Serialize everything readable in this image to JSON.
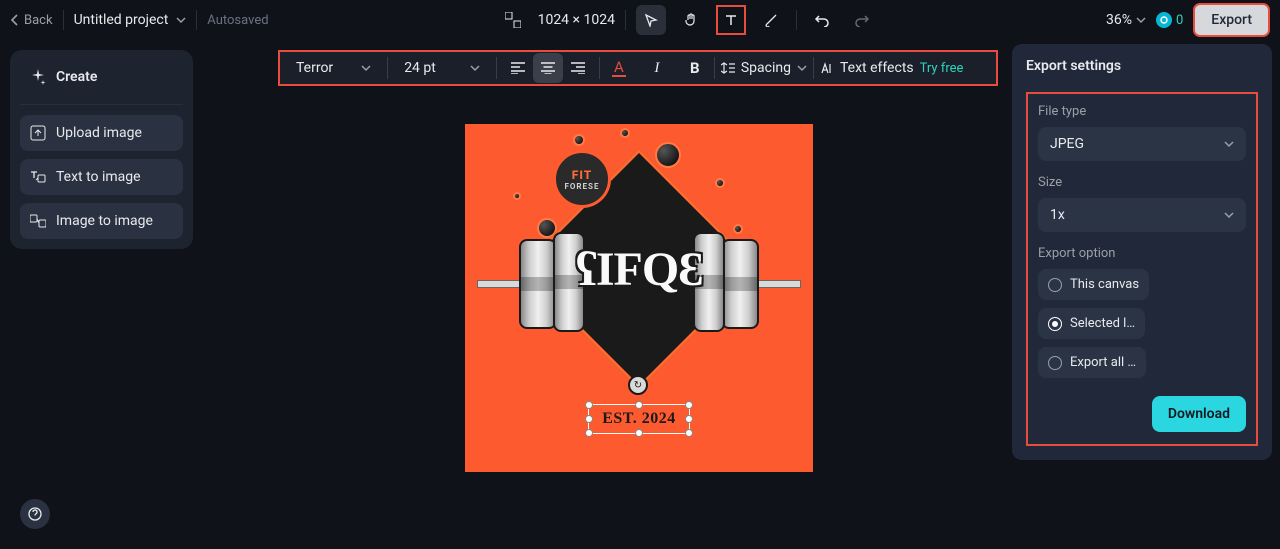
{
  "topbar": {
    "back": "Back",
    "project_name": "Untitled project",
    "autosaved": "Autosaved",
    "dimensions": "1024 × 1024",
    "zoom": "36%",
    "credits": "0",
    "export": "Export"
  },
  "text_toolbar": {
    "font": "Terror",
    "size": "24 pt",
    "spacing": "Spacing",
    "effects": "Text effects",
    "try_free": "Try free"
  },
  "left_panel": {
    "create": "Create",
    "upload": "Upload image",
    "text_to_image": "Text to image",
    "image_to_image": "Image to image"
  },
  "artboard": {
    "badge_l1": "FIT",
    "badge_l2": "FORESE",
    "title": "ʕIFQƐ",
    "est": "EST. 2024"
  },
  "export_panel": {
    "title": "Export settings",
    "file_type_label": "File type",
    "file_type": "JPEG",
    "size_label": "Size",
    "size": "1x",
    "option_label": "Export option",
    "opt_canvas": "This canvas",
    "opt_selected": "Selected l…",
    "opt_all": "Export all …",
    "download": "Download"
  }
}
